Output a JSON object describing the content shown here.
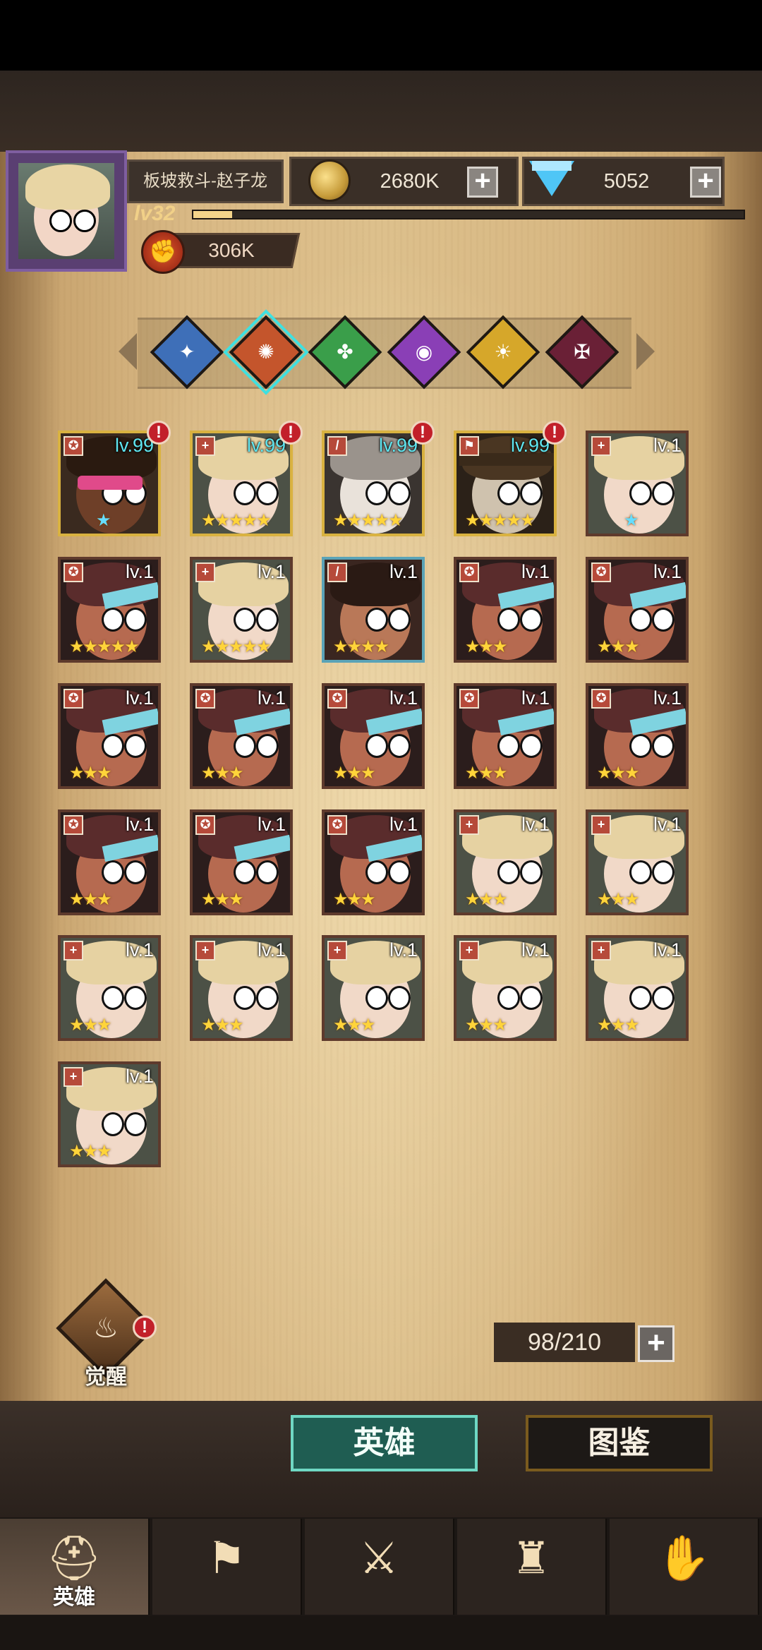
{
  "player": {
    "name": "板坡救斗-赵子龙",
    "level": "lv32",
    "power": "306K",
    "xp_fraction": 0.07
  },
  "currencies": {
    "gold": "2680K",
    "gems": "5052",
    "plus": "+"
  },
  "factions": [
    {
      "name": "faction-wind",
      "color": "#3e6fb8",
      "glyph": "✦"
    },
    {
      "name": "faction-fire",
      "color": "#c4552c",
      "glyph": "✺"
    },
    {
      "name": "faction-nature",
      "color": "#3a9e4a",
      "glyph": "✤"
    },
    {
      "name": "faction-arcane",
      "color": "#8a3fb6",
      "glyph": "◉"
    },
    {
      "name": "faction-light",
      "color": "#d6a72a",
      "glyph": "☀"
    },
    {
      "name": "faction-dark",
      "color": "#6a2036",
      "glyph": "✠"
    }
  ],
  "heroes": [
    {
      "lv": "lv.99",
      "stars": "★",
      "badge": "✪",
      "frame": "gold",
      "alert": "!",
      "face": "dark"
    },
    {
      "lv": "lv.99",
      "stars": "★★★★★",
      "badge": "+",
      "frame": "gold",
      "alert": "!",
      "face": "blonde"
    },
    {
      "lv": "lv.99",
      "stars": "★★★★★",
      "badge": "/",
      "frame": "gold",
      "alert": "!",
      "face": "grey"
    },
    {
      "lv": "lv.99",
      "stars": "★★★★★",
      "badge": "⚑",
      "frame": "gold",
      "alert": "!",
      "face": "hat"
    },
    {
      "lv": "lv.1",
      "stars": "★",
      "badge": "+",
      "frame": "brown",
      "face": "blonde"
    },
    {
      "lv": "lv.1",
      "stars": "★★★★★",
      "badge": "✪",
      "frame": "brown",
      "face": "goggle"
    },
    {
      "lv": "lv.1",
      "stars": "★★★★★",
      "badge": "+",
      "frame": "brown",
      "face": "blonde"
    },
    {
      "lv": "lv.1",
      "stars": "★★★★",
      "badge": "/",
      "frame": "blue",
      "face": "brute"
    },
    {
      "lv": "lv.1",
      "stars": "★★★",
      "badge": "✪",
      "frame": "brown",
      "face": "goggle"
    },
    {
      "lv": "lv.1",
      "stars": "★★★",
      "badge": "✪",
      "frame": "brown",
      "face": "goggle"
    },
    {
      "lv": "lv.1",
      "stars": "★★★",
      "badge": "✪",
      "frame": "brown",
      "face": "goggle"
    },
    {
      "lv": "lv.1",
      "stars": "★★★",
      "badge": "✪",
      "frame": "brown",
      "face": "goggle"
    },
    {
      "lv": "lv.1",
      "stars": "★★★",
      "badge": "✪",
      "frame": "brown",
      "face": "goggle"
    },
    {
      "lv": "lv.1",
      "stars": "★★★",
      "badge": "✪",
      "frame": "brown",
      "face": "goggle"
    },
    {
      "lv": "lv.1",
      "stars": "★★★",
      "badge": "✪",
      "frame": "brown",
      "face": "goggle"
    },
    {
      "lv": "lv.1",
      "stars": "★★★",
      "badge": "✪",
      "frame": "brown",
      "face": "goggle"
    },
    {
      "lv": "lv.1",
      "stars": "★★★",
      "badge": "✪",
      "frame": "brown",
      "face": "goggle"
    },
    {
      "lv": "lv.1",
      "stars": "★★★",
      "badge": "✪",
      "frame": "brown",
      "face": "goggle"
    },
    {
      "lv": "lv.1",
      "stars": "★★★",
      "badge": "+",
      "frame": "brown",
      "face": "blonde"
    },
    {
      "lv": "lv.1",
      "stars": "★★★",
      "badge": "+",
      "frame": "brown",
      "face": "blonde"
    },
    {
      "lv": "lv.1",
      "stars": "★★★",
      "badge": "+",
      "frame": "brown",
      "face": "blonde"
    },
    {
      "lv": "lv.1",
      "stars": "★★★",
      "badge": "+",
      "frame": "brown",
      "face": "blonde"
    },
    {
      "lv": "lv.1",
      "stars": "★★★",
      "badge": "+",
      "frame": "brown",
      "face": "blonde"
    },
    {
      "lv": "lv.1",
      "stars": "★★★",
      "badge": "+",
      "frame": "brown",
      "face": "blonde"
    },
    {
      "lv": "lv.1",
      "stars": "★★★",
      "badge": "+",
      "frame": "brown",
      "face": "blonde"
    },
    {
      "lv": "lv.1",
      "stars": "★★★",
      "badge": "+",
      "frame": "brown",
      "face": "blonde"
    }
  ],
  "awaken": {
    "label": "觉醒",
    "alert": "!"
  },
  "roster": {
    "count": "98/210",
    "plus": "+"
  },
  "segments": {
    "heroes": "英雄",
    "codex": "图鉴"
  },
  "nav": [
    {
      "label": "英雄",
      "icon": "⛑",
      "active": true
    },
    {
      "label": "",
      "icon": "⚑",
      "active": false
    },
    {
      "label": "",
      "icon": "⚔",
      "active": false
    },
    {
      "label": "",
      "icon": "♜",
      "active": false
    },
    {
      "label": "",
      "icon": "✋",
      "active": false
    }
  ]
}
